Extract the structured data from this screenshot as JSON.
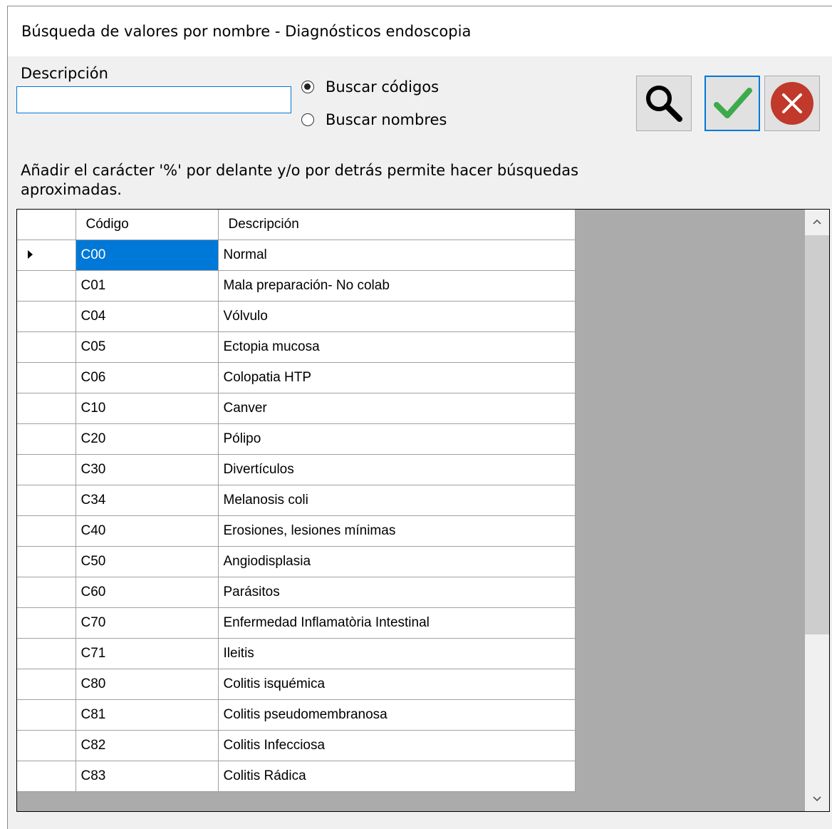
{
  "window": {
    "title": "Búsqueda de valores por nombre - Diagnósticos endoscopia"
  },
  "search": {
    "label": "Descripción",
    "value": "",
    "placeholder": ""
  },
  "options": {
    "codes_label": "Buscar códigos",
    "names_label": "Buscar nombres",
    "selected": "codes"
  },
  "toolbar": {
    "search_icon": "search-icon",
    "accept_icon": "checkmark-icon",
    "cancel_icon": "close-circle-icon",
    "accept_color": "#3daa4c",
    "cancel_color": "#c0392b"
  },
  "hint": "Añadir el carácter '%' por delante y/o por detrás permite hacer búsquedas aproximadas.",
  "table": {
    "headers": [
      "Código",
      "Descripción"
    ],
    "selected_row": 0,
    "rows": [
      [
        "C00",
        "Normal"
      ],
      [
        "C01",
        "Mala preparación- No colab"
      ],
      [
        "C04",
        "Vólvulo"
      ],
      [
        "C05",
        "Ectopia mucosa"
      ],
      [
        "C06",
        "Colopatia HTP"
      ],
      [
        "C10",
        "Canver"
      ],
      [
        "C20",
        "Pólipo"
      ],
      [
        "C30",
        "Divertículos"
      ],
      [
        "C34",
        "Melanosis coli"
      ],
      [
        "C40",
        "Erosiones, lesiones mínimas"
      ],
      [
        "C50",
        "Angiodisplasia"
      ],
      [
        "C60",
        "Parásitos"
      ],
      [
        "C70",
        "Enfermedad Inflamatòria Intestinal"
      ],
      [
        "C71",
        "Ileitis"
      ],
      [
        "C80",
        "Colitis isquémica"
      ],
      [
        "C81",
        "Colitis pseudomembranosa"
      ],
      [
        "C82",
        "Colitis Infecciosa"
      ],
      [
        "C83",
        "Colitis Rádica"
      ]
    ]
  }
}
